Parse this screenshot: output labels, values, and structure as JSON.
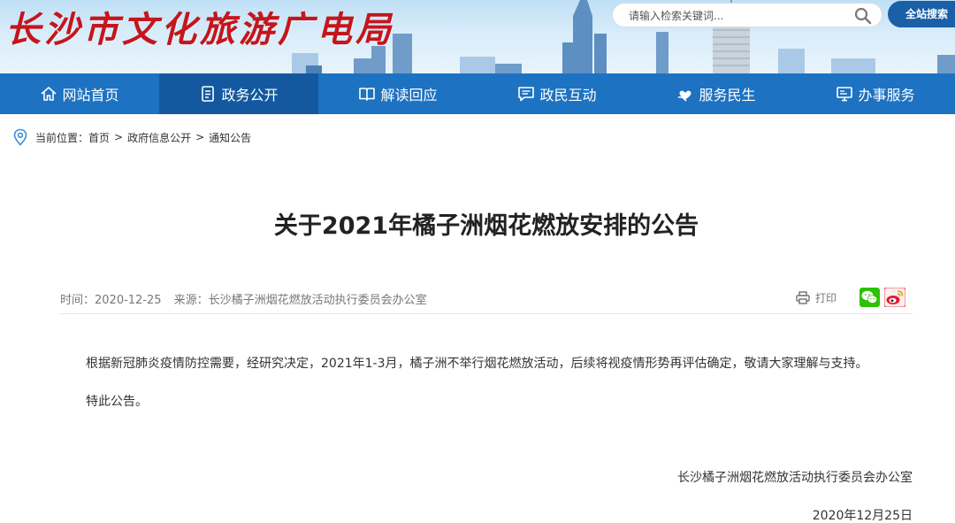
{
  "header": {
    "logo_text": "长沙市文化旅游广电局",
    "search": {
      "placeholder": "请输入检索关键词..."
    },
    "site_search_label": "全站搜索"
  },
  "nav": {
    "items": [
      {
        "label": "网站首页",
        "icon": "home-icon"
      },
      {
        "label": "政务公开",
        "icon": "document-icon",
        "active": true
      },
      {
        "label": "解读回应",
        "icon": "book-icon"
      },
      {
        "label": "政民互动",
        "icon": "chat-icon"
      },
      {
        "label": "服务民生",
        "icon": "heart-hand-icon"
      },
      {
        "label": "办事服务",
        "icon": "computer-icon"
      }
    ]
  },
  "breadcrumb": {
    "prefix": "当前位置：",
    "items": [
      "首页",
      "政府信息公开",
      "通知公告"
    ],
    "separator": ">"
  },
  "article": {
    "title": "关于2021年橘子洲烟花燃放安排的公告",
    "time_label": "时间：",
    "time": "2020-12-25",
    "source_label": "来源：",
    "source": "长沙橘子洲烟花燃放活动执行委员会办公室",
    "print_label": "打印",
    "paragraphs": [
      "根据新冠肺炎疫情防控需要，经研究决定，2021年1-3月，橘子洲不举行烟花燃放活动，后续将视疫情形势再评估确定，敬请大家理解与支持。",
      "特此公告。"
    ],
    "signature": "长沙橘子洲烟花燃放活动执行委员会办公室",
    "date": "2020年12月25日"
  },
  "colors": {
    "nav_bg": "#1d72c1",
    "nav_active_bg": "#1459a0",
    "logo_red": "#c4161c",
    "search_button": "#1a5fa8",
    "wechat_green": "#2dc100",
    "weibo_red": "#e6162d"
  }
}
